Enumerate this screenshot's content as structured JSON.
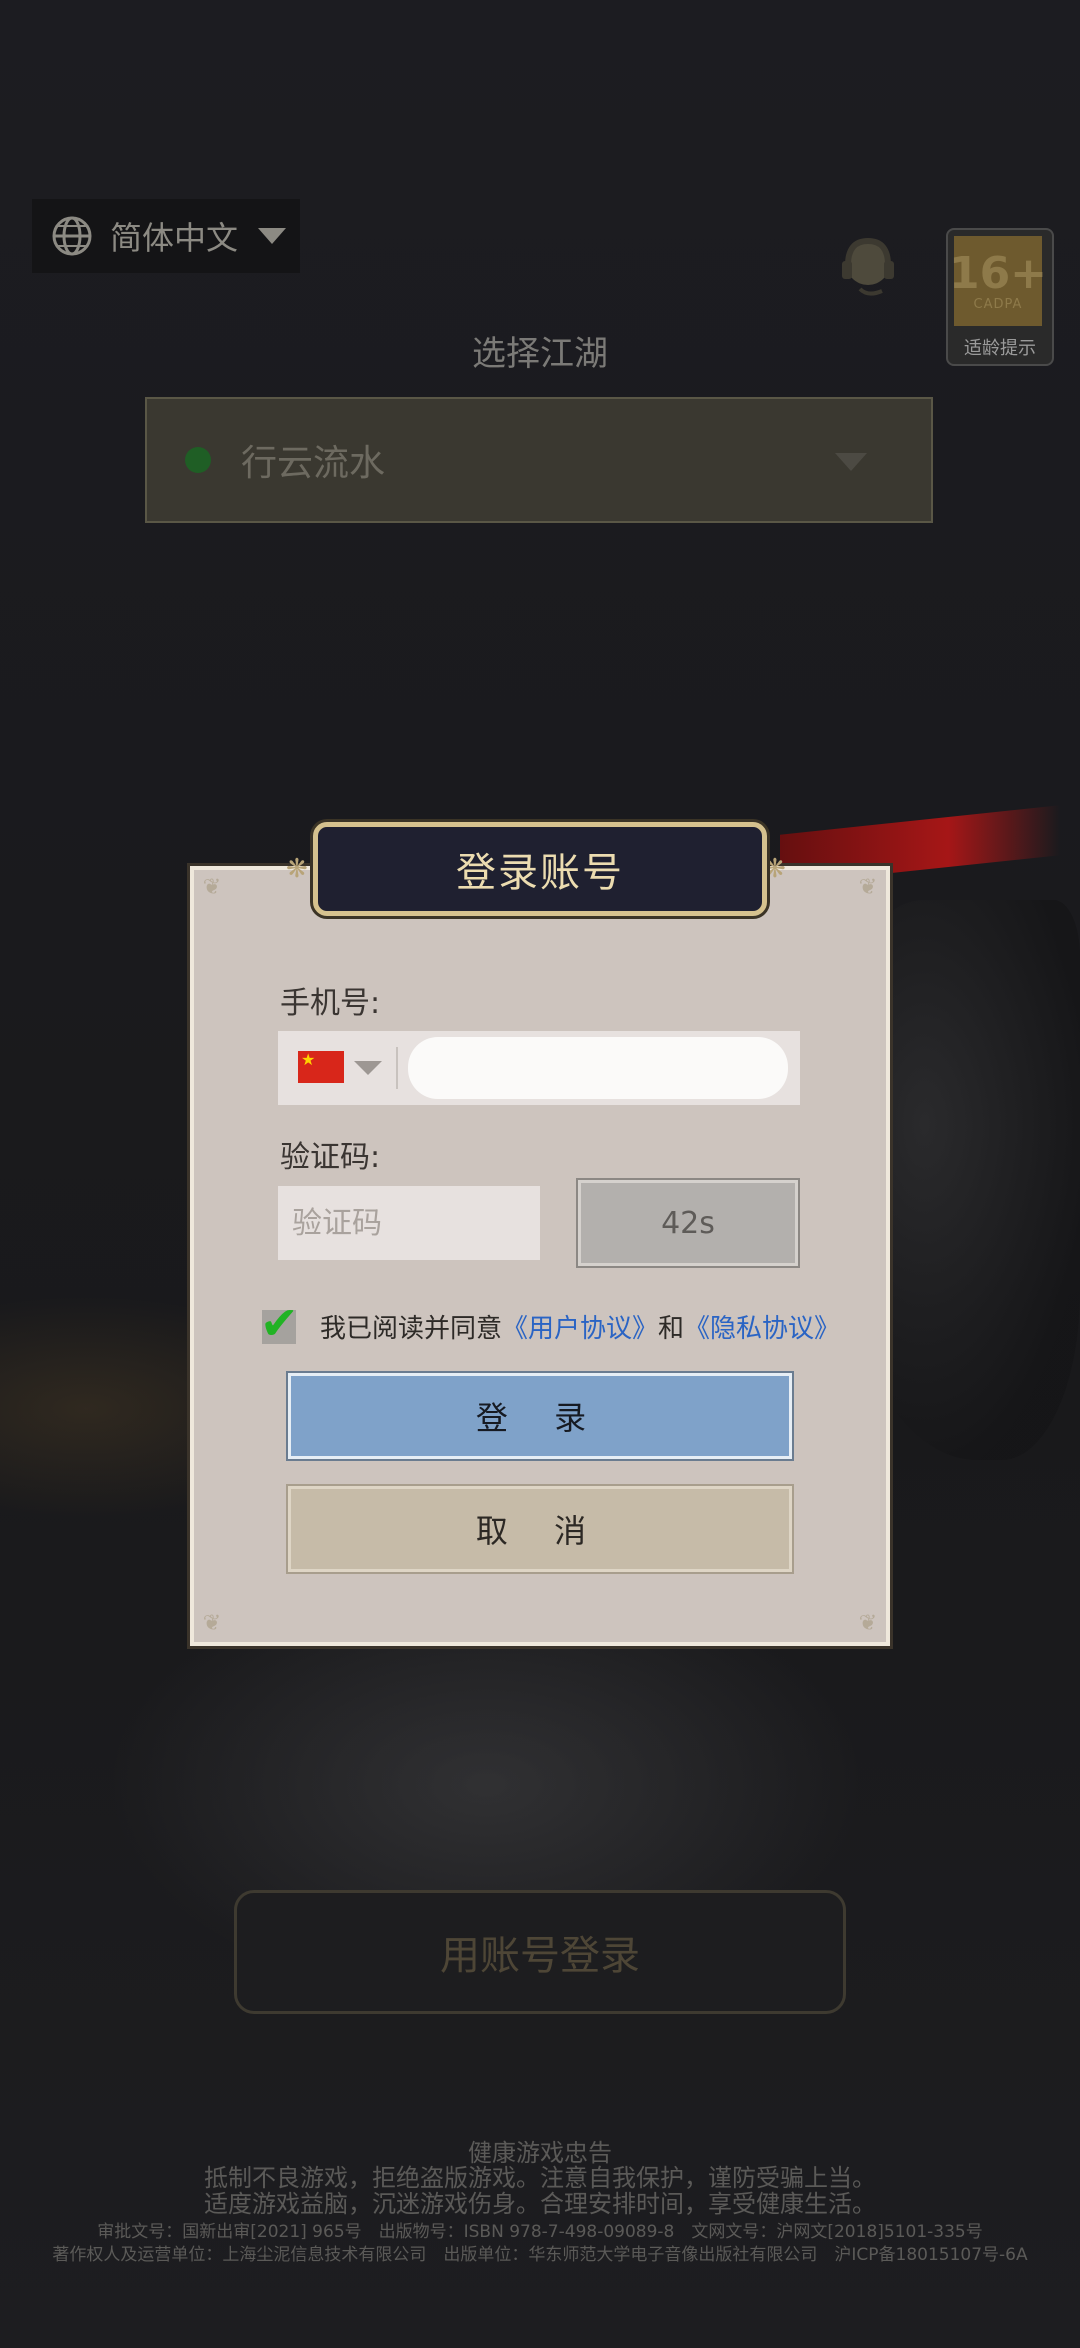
{
  "top": {
    "language": "简体中文",
    "age_rating": {
      "number": "16+",
      "org": "CADPA",
      "label": "适龄提示"
    }
  },
  "server": {
    "title": "选择江湖",
    "name": "行云流水",
    "status_color": "#1f5e25"
  },
  "dialog": {
    "title": "登录账号",
    "phone_label": "手机号:",
    "phone_value": "",
    "code_label": "验证码:",
    "code_placeholder": "验证码",
    "countdown": "42s",
    "agree_prefix": "我已阅读并同意",
    "user_agreement": "《用户协议》",
    "and": "和",
    "privacy_agreement": "《隐私协议》",
    "agree_checked": true,
    "login_button": "登 录",
    "cancel_button": "取 消"
  },
  "account_login_button": "用账号登录",
  "footer": {
    "line1": "健康游戏忠告",
    "line2": "抵制不良游戏，拒绝盗版游戏。注意自我保护，谨防受骗上当。",
    "line3": "适度游戏益脑，沉迷游戏伤身。合理安排时间，享受健康生活。",
    "line4": "审批文号：国新出审[2021] 965号　出版物号：ISBN 978-7-498-09089-8　文网文号：沪网文[2018]5101-335号",
    "line5": "著作权人及运营单位：上海尘泥信息技术有限公司　出版单位：华东师范大学电子音像出版社有限公司　沪ICP备18015107号-6A"
  },
  "colors": {
    "accent_blue": "#7fa2c9",
    "link_blue": "#2a64c4",
    "gold": "#d6c28e"
  }
}
